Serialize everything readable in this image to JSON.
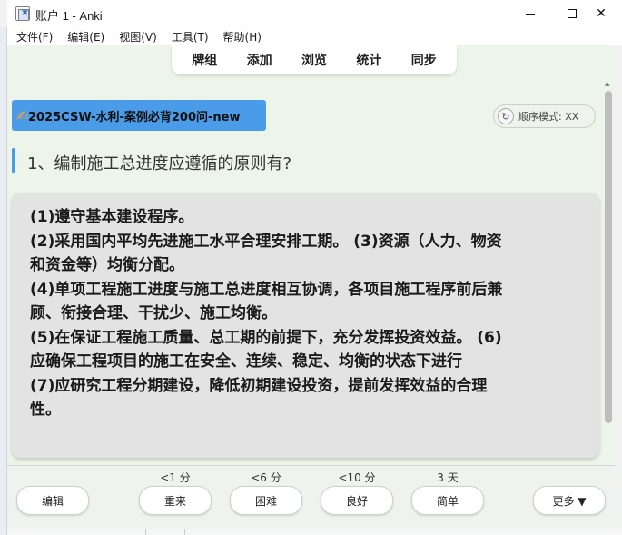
{
  "window": {
    "title": "账户 1 - Anki",
    "controls": {
      "minimize": "—",
      "maximize": "☐",
      "close": "✕"
    }
  },
  "menubar": {
    "items": [
      "文件(F)",
      "编辑(E)",
      "视图(V)",
      "工具(T)",
      "帮助(H)"
    ]
  },
  "toolbar": {
    "items": [
      "牌组",
      "添加",
      "浏览",
      "统计",
      "同步"
    ]
  },
  "card": {
    "deck_name": "2025CSW-水利-案例必背200问-new",
    "order_mode": "顺序模式: XX",
    "question": "1、编制施工总进度应遵循的原则有?",
    "answer_lines": [
      "(1)遵守基本建设程序。",
      "(2)采用国内平均先进施工水平合理安排工期。 (3)资源（人力、物资",
      "和资金等）均衡分配。",
      "(4)单项工程施工进度与施工总进度相互协调，各项目施工程序前后兼",
      "顾、衔接合理、干扰少、施工均衡。",
      "(5)在保证工程施工质量、总工期的前提下，充分发挥投资效益。 (6)",
      "应确保工程项目的施工在安全、连续、稳定、均衡的状态下进行",
      "(7)应研究工程分期建设，降低初期建设投资，提前发挥效益的合理",
      "性。"
    ]
  },
  "review": {
    "edit_label": "编辑",
    "more_label": "更多 ▼",
    "answers": [
      {
        "label": "重来",
        "due": "<1 分"
      },
      {
        "label": "困难",
        "due": "<6 分"
      },
      {
        "label": "良好",
        "due": "<10 分"
      },
      {
        "label": "简单",
        "due": "3 天"
      }
    ]
  },
  "colors": {
    "accent_blue": "#4a9be8",
    "content_bg": "#edf5ea",
    "answer_bg": "#e3e3e3"
  }
}
